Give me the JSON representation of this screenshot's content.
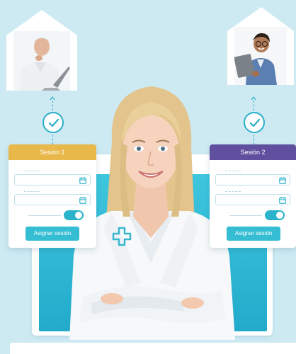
{
  "sessions": [
    {
      "title": "Sesión 1",
      "header_color": "#e9b84a",
      "button_label": "Asignar sesión",
      "toggle_on": true
    },
    {
      "title": "Sesión 2",
      "header_color": "#5f4f9e",
      "button_label": "Asignar sesión",
      "toggle_on": true
    }
  ],
  "icons": {
    "check": "check-icon",
    "calendar": "calendar-icon",
    "medical_cross": "medical-cross-icon",
    "arrow_up": "arrow-up-icon"
  },
  "colors": {
    "background": "#cdeaf3",
    "accent": "#2bb3cc",
    "session_1": "#e9b84a",
    "session_2": "#5f4f9e"
  }
}
